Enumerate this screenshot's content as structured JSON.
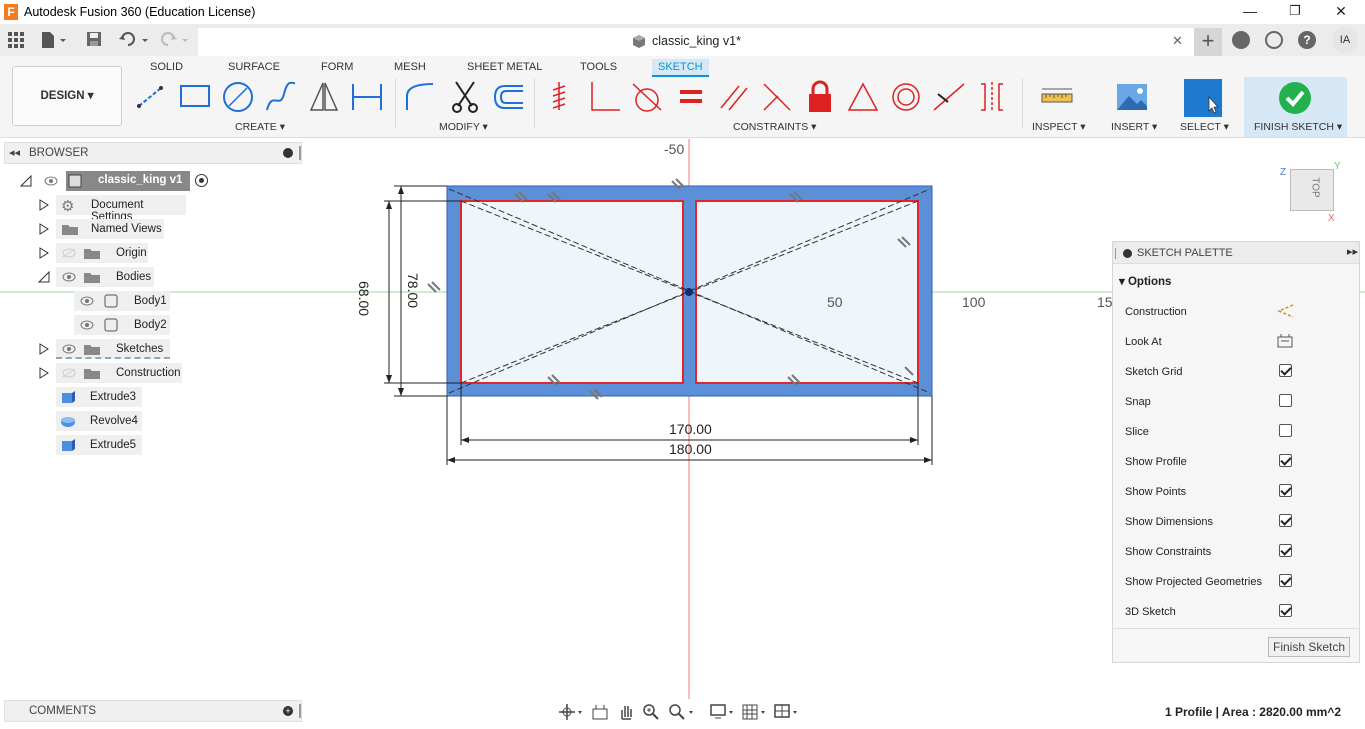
{
  "window": {
    "title": "Autodesk Fusion 360 (Education License)",
    "app_logo_letter": "F",
    "minimize_glyph": "—",
    "restore_glyph": "❐",
    "close_glyph": "✕"
  },
  "document_tab": {
    "name": "classic_king v1*",
    "close_glyph": "✕"
  },
  "header_right": {
    "user_initials": "IA",
    "add_glyph": "+",
    "help_glyph": "?"
  },
  "ribbon": {
    "workspace_button": "DESIGN ▾",
    "tabs": [
      {
        "label": "SOLID",
        "active": false
      },
      {
        "label": "SURFACE",
        "active": false
      },
      {
        "label": "FORM",
        "active": false
      },
      {
        "label": "MESH",
        "active": false
      },
      {
        "label": "SHEET METAL",
        "active": false
      },
      {
        "label": "TOOLS",
        "active": false
      },
      {
        "label": "SKETCH",
        "active": true
      }
    ],
    "groups": {
      "create": "CREATE ▾",
      "modify": "MODIFY ▾",
      "constraints": "CONSTRAINTS ▾",
      "inspect": "INSPECT ▾",
      "insert": "INSERT ▾",
      "select": "SELECT ▾",
      "finish": "FINISH SKETCH ▾"
    },
    "tool_icons": {
      "create": [
        "line-icon",
        "rectangle-icon",
        "circle-icon",
        "spline-icon",
        "mirror-icon",
        "dimension-icon"
      ],
      "modify": [
        "fillet-icon",
        "trim-icon",
        "offset-icon"
      ],
      "constraints": [
        "fix-icon",
        "coincident-perpendicular-icon",
        "tangent-icon",
        "equal-icon",
        "parallel-icon",
        "perpendicular-icon",
        "lock-icon",
        "triangle-icon",
        "concentric-icon",
        "midpoint-icon",
        "symmetry-icon"
      ]
    }
  },
  "browser": {
    "title": "BROWSER",
    "root": "classic_king v1",
    "items": [
      {
        "label": "Document Settings",
        "icon": "gear-icon",
        "expandable": true
      },
      {
        "label": "Named Views",
        "icon": "folder-icon",
        "expandable": true
      },
      {
        "label": "Origin",
        "icon": "folder-icon",
        "expandable": true,
        "hidden": true
      },
      {
        "label": "Bodies",
        "icon": "folder-icon",
        "expandable": true,
        "expanded": true
      },
      {
        "label": "Body1",
        "icon": "body-icon",
        "child": true
      },
      {
        "label": "Body2",
        "icon": "body-icon",
        "child": true
      },
      {
        "label": "Sketches",
        "icon": "folder-icon",
        "expandable": true
      },
      {
        "label": "Construction",
        "icon": "folder-icon",
        "expandable": true,
        "hidden": true
      }
    ],
    "features": [
      {
        "label": "Extrude3",
        "icon": "extrude-icon"
      },
      {
        "label": "Revolve4",
        "icon": "revolve-icon"
      },
      {
        "label": "Extrude5",
        "icon": "extrude-icon"
      }
    ]
  },
  "canvas": {
    "axis_labels": {
      "top": "-50",
      "x_50": "50",
      "x_100": "100",
      "x_150": "15"
    },
    "dimensions": {
      "inner_width": "170.00",
      "outer_width": "180.00",
      "inner_height": "68.00",
      "outer_height": "78.00"
    },
    "viewcube": {
      "face": "TOP",
      "axis_x": "X",
      "axis_y": "Y",
      "axis_z": "Z"
    }
  },
  "sketch_palette": {
    "title": "SKETCH PALETTE",
    "section": "Options",
    "rows": [
      {
        "label": "Construction",
        "type": "icon",
        "icon": "construction-icon"
      },
      {
        "label": "Look At",
        "type": "icon",
        "icon": "look-at-icon"
      },
      {
        "label": "Sketch Grid",
        "type": "check",
        "checked": true
      },
      {
        "label": "Snap",
        "type": "check",
        "checked": false
      },
      {
        "label": "Slice",
        "type": "check",
        "checked": false
      },
      {
        "label": "Show Profile",
        "type": "check",
        "checked": true
      },
      {
        "label": "Show Points",
        "type": "check",
        "checked": true
      },
      {
        "label": "Show Dimensions",
        "type": "check",
        "checked": true
      },
      {
        "label": "Show Constraints",
        "type": "check",
        "checked": true
      },
      {
        "label": "Show Projected Geometries",
        "type": "check",
        "checked": true
      },
      {
        "label": "3D Sketch",
        "type": "check",
        "checked": true
      }
    ],
    "finish_button": "Finish Sketch"
  },
  "comments": {
    "title": "COMMENTS"
  },
  "status": {
    "text": "1 Profile | Area : 2820.00 mm^2"
  },
  "colors": {
    "accent": "#0696d7",
    "profile_fill": "#5b8fd8",
    "sketch_line": "#e0262b",
    "finish_green": "#23b14d"
  }
}
